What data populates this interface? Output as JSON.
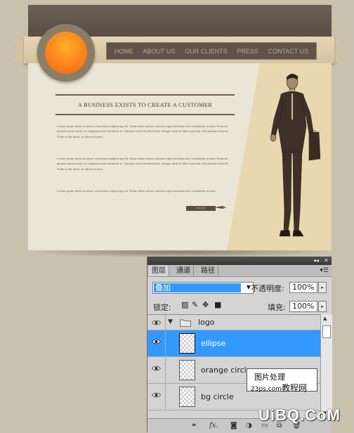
{
  "website": {
    "nav": [
      "HOME",
      "ABOUT US",
      "OUR CLIENTS",
      "PRESS",
      "CONTACT US"
    ],
    "headline": "A BUSINESS EXISTS TO CREATE A CUSTOMER",
    "paragraphs": [
      "Lorem ipsum dolor sit amet, consectetur adipiscing elit. Etiam tellus metus, ultricies eget interdum sed, vestibulum ut urna. Praesent pharetra porta nulla, eu vulputate nunc hendrerit et. Quisque vitae eleifend dolor. Integer ultrices libero gravida velit pretium lobortis. Nulla et dui dolor, in ultrices lorem.",
      "Lorem ipsum dolor sit amet, consectetur adipiscing elit. Etiam tellus metus, ultricies eget interdum sed, vestibulum ut urna. Praesent pharetra porta nulla, eu vulputate nunc hendrerit et. Quisque vitae eleifend dolor. Integer ultrices libero gravida velit pretium lobortis. Nulla et dui dolor, in ultrices lorem.",
      "Lorem ipsum dolor sit amet, consectetur adipiscing elit. Etiam tellus metus, ultricies eget interdum sed, vestibulum ut urna."
    ],
    "more_button": "see more"
  },
  "layers_panel": {
    "tabs": [
      "图层",
      "通道",
      "路径"
    ],
    "blend_mode": "叠加",
    "opacity_label": "不透明度:",
    "opacity_value": "100%",
    "lock_label": "锁定:",
    "fill_label": "填充:",
    "fill_value": "100%",
    "layers": [
      {
        "name": "logo",
        "type": "group"
      },
      {
        "name": "ellipse",
        "selected": true
      },
      {
        "name": "orange circle"
      },
      {
        "name": "bg circle"
      }
    ],
    "footer_icons": [
      "link-icon",
      "fx-icon",
      "mask-icon",
      "adjustment-icon",
      "folder-icon",
      "new-layer-icon",
      "trash-icon"
    ]
  },
  "watermarks": {
    "line1": "图片处理",
    "line2_site": "23ps.com",
    "line2_text": "教程网",
    "brand": "UiBQ.CoM"
  },
  "colors": {
    "accent_orange": "#ff8a1c",
    "selection_blue": "#3399ff",
    "nav_text": "#c0a486"
  }
}
